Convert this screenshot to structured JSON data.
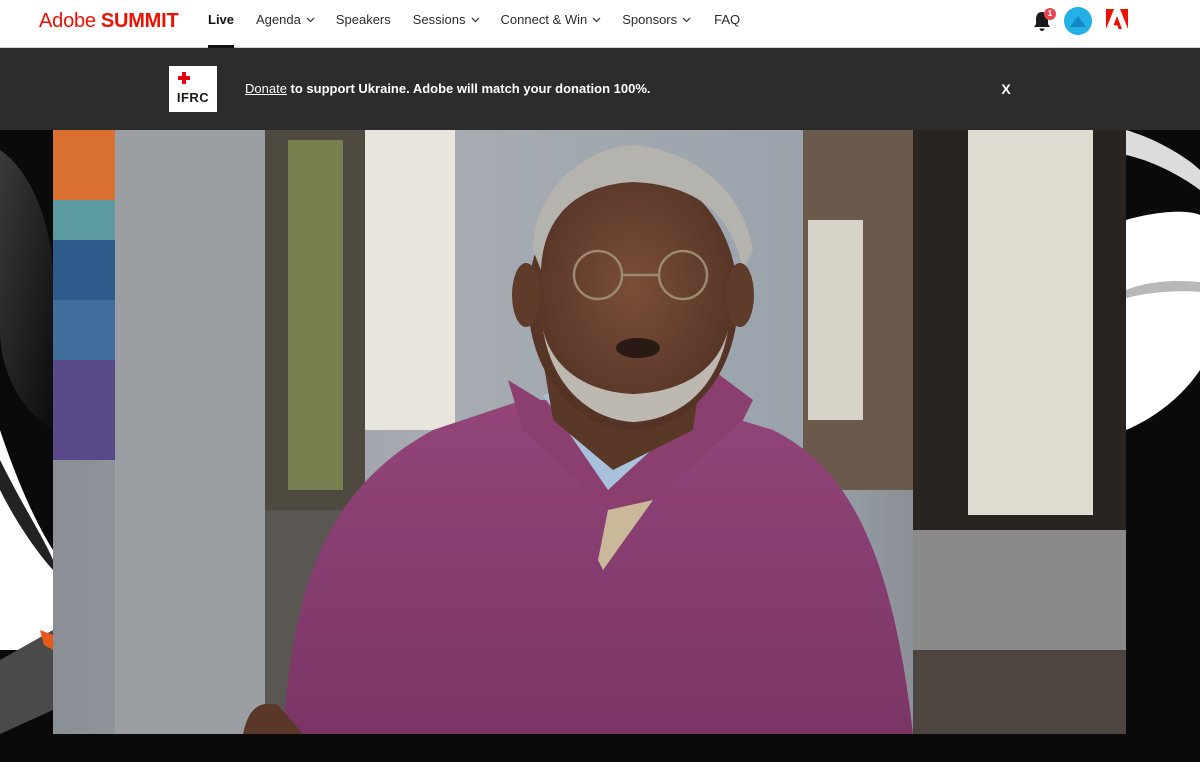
{
  "brand": {
    "name_regular": "Adobe",
    "name_bold": "SUMMIT",
    "color": "#eb1000"
  },
  "nav": {
    "items": [
      {
        "label": "Live",
        "active": true,
        "dropdown": false
      },
      {
        "label": "Agenda",
        "active": false,
        "dropdown": true
      },
      {
        "label": "Speakers",
        "active": false,
        "dropdown": false
      },
      {
        "label": "Sessions",
        "active": false,
        "dropdown": true
      },
      {
        "label": "Connect & Win",
        "active": false,
        "dropdown": true
      },
      {
        "label": "Sponsors",
        "active": false,
        "dropdown": true
      },
      {
        "label": "FAQ",
        "active": false,
        "dropdown": false
      }
    ],
    "notification_count": "1",
    "icons": {
      "notifications": "bell-icon",
      "profile": "avatar",
      "adobe": "adobe-logo-icon"
    }
  },
  "banner": {
    "logo_text": "IFRC",
    "link_text": "Donate",
    "message": " to support Ukraine. Adobe will match your donation 100%.",
    "close_label": "X",
    "background": "#2c2c2c"
  },
  "video": {
    "accent_colors": {
      "sweater": "#8a3f6e",
      "frame": "#000000"
    }
  }
}
